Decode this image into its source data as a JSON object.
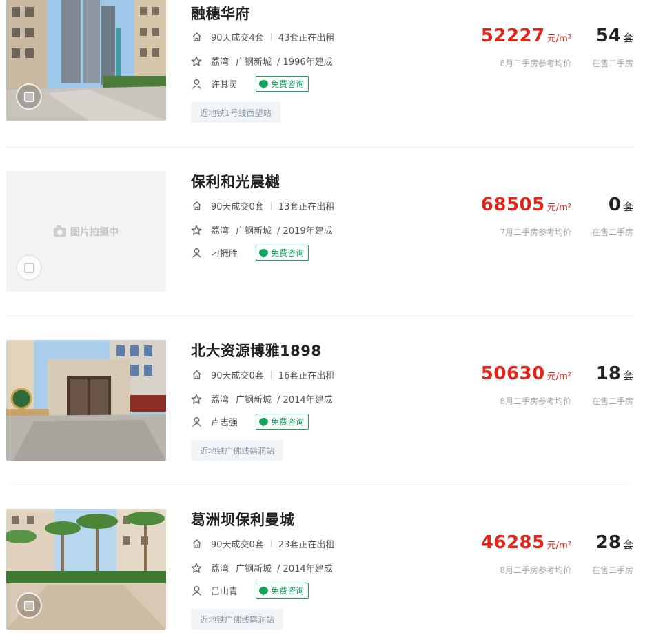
{
  "listings": [
    {
      "name": "融穗华府",
      "deals_90d": "90天成交4套",
      "renting": "43套正在出租",
      "district": "荔湾",
      "area": "广钢新城",
      "built": "/ 1996年建成",
      "agent": "许其灵",
      "consult_label": "免费咨询",
      "subway": "近地铁1号线西塱站",
      "price": "52227",
      "price_unit": "元/m²",
      "price_note": "8月二手房参考均价",
      "on_sale": "54",
      "on_sale_unit": "套",
      "on_sale_note": "在售二手房"
    },
    {
      "name": "保利和光晨樾",
      "deals_90d": "90天成交0套",
      "renting": "13套正在出租",
      "district": "荔湾",
      "area": "广钢新城",
      "built": "/ 2019年建成",
      "agent": "刁振胜",
      "consult_label": "免费咨询",
      "placeholder": "图片拍摄中",
      "price": "68505",
      "price_unit": "元/m²",
      "price_note": "7月二手房参考均价",
      "on_sale": "0",
      "on_sale_unit": "套",
      "on_sale_note": "在售二手房"
    },
    {
      "name": "北大资源博雅1898",
      "deals_90d": "90天成交0套",
      "renting": "16套正在出租",
      "district": "荔湾",
      "area": "广钢新城",
      "built": "/ 2014年建成",
      "agent": "卢志强",
      "consult_label": "免费咨询",
      "subway": "近地铁广佛线鹤洞站",
      "price": "50630",
      "price_unit": "元/m²",
      "price_note": "8月二手房参考均价",
      "on_sale": "18",
      "on_sale_unit": "套",
      "on_sale_note": "在售二手房"
    },
    {
      "name": "葛洲坝保利曼城",
      "deals_90d": "90天成交0套",
      "renting": "23套正在出租",
      "district": "荔湾",
      "area": "广钢新城",
      "built": "/ 2014年建成",
      "agent": "吕山青",
      "consult_label": "免费咨询",
      "subway": "近地铁广佛线鹤洞站",
      "price": "46285",
      "price_unit": "元/m²",
      "price_note": "8月二手房参考均价",
      "on_sale": "28",
      "on_sale_unit": "套",
      "on_sale_note": "在售二手房"
    }
  ],
  "colors": {
    "price_red": "#e1251b",
    "consult_green": "#13a45b",
    "subway_bg": "#f2f5f7"
  },
  "icons": {
    "deals": "home-icon",
    "location": "star-icon",
    "agent": "person-icon",
    "consult": "chat-icon",
    "vr": "vr-cube-icon",
    "placeholder": "camera-icon"
  }
}
